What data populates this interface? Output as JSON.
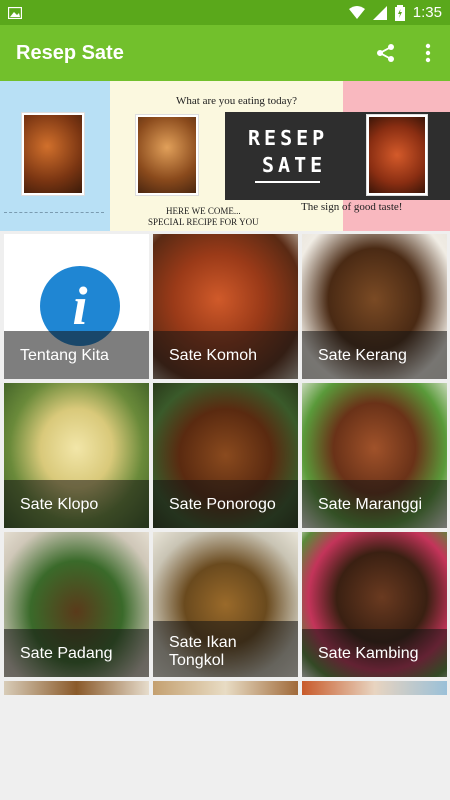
{
  "status": {
    "time": "1:35"
  },
  "app_bar": {
    "title": "Resep Sate",
    "share_icon": "share-icon",
    "menu_icon": "more-vert-icon"
  },
  "banner": {
    "question": "What are you eating today?",
    "here_line1": "HERE WE COME...",
    "here_line2": "SPECIAL RECIPE FOR YOU",
    "logo_line1": "RESEP",
    "logo_line2": "SATE",
    "tagline": "The sign of good taste!"
  },
  "grid": {
    "items": [
      {
        "label": "Tentang Kita"
      },
      {
        "label": "Sate Komoh"
      },
      {
        "label": "Sate Kerang"
      },
      {
        "label": "Sate Klopo"
      },
      {
        "label": "Sate Ponorogo"
      },
      {
        "label": "Sate Maranggi"
      },
      {
        "label": "Sate Padang"
      },
      {
        "label": "Sate Ikan",
        "label2": "Tongkol"
      },
      {
        "label": "Sate Kambing"
      }
    ]
  },
  "colors": {
    "app_bar": "#72c02c",
    "status_bar": "#5aa81b",
    "info": "#1f86d3"
  }
}
